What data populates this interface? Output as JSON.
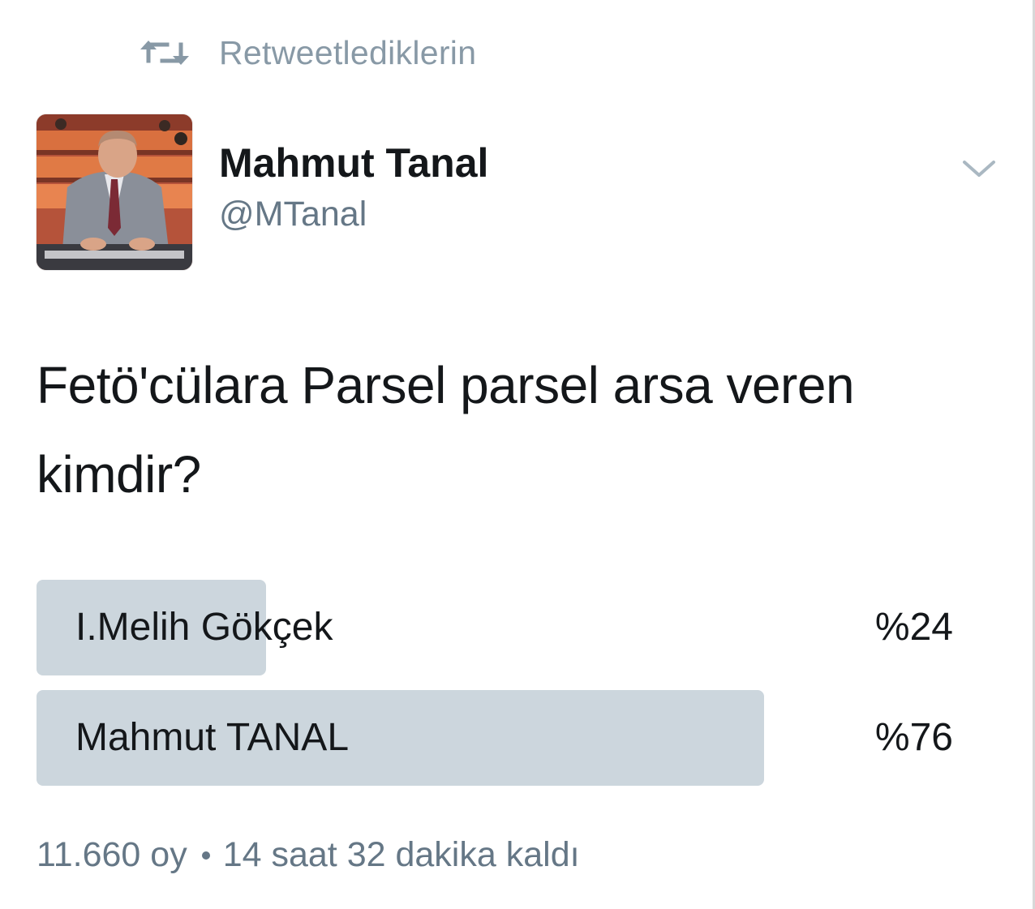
{
  "retweet_header": {
    "icon": "retweet-icon",
    "label": "Retweetlediklerin"
  },
  "author": {
    "name": "Mahmut Tanal",
    "handle": "@MTanal",
    "avatar_icon": "profile-photo",
    "menu_icon": "chevron-down-icon"
  },
  "tweet": {
    "text": "Fetö'cülara Parsel parsel arsa veren kimdir?"
  },
  "poll": {
    "options": [
      {
        "label": "I.Melih Gökçek",
        "percent_text": "%24",
        "percent": 24
      },
      {
        "label": "Mahmut TANAL",
        "percent_text": "%76",
        "percent": 76
      }
    ],
    "votes": "11.660 oy",
    "time_left": "14 saat 32 dakika kaldı"
  },
  "colors": {
    "bar": "#ccd6dd",
    "text": "#14171a",
    "muted": "#657786",
    "header_gray": "#8899a6"
  }
}
